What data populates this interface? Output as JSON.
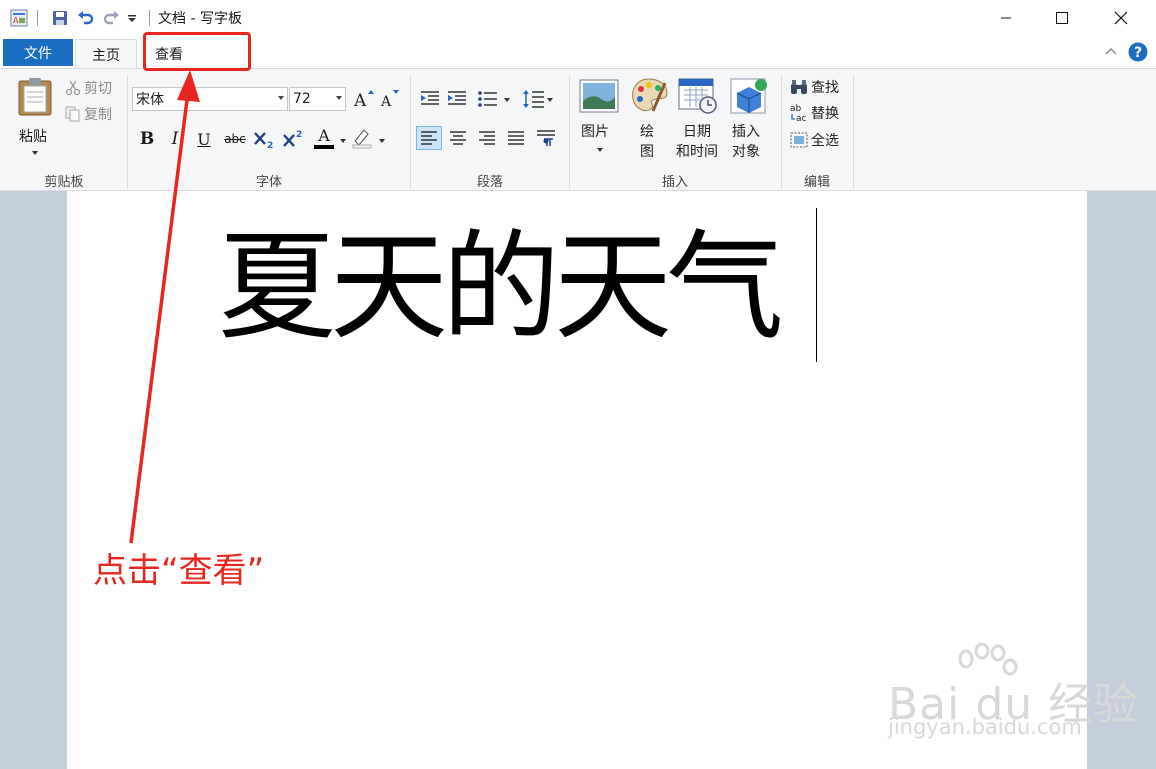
{
  "window": {
    "title": "文档 - 写字板"
  },
  "tabs": {
    "file": "文件",
    "home": "主页",
    "view": "查看"
  },
  "ribbon": {
    "clipboard": {
      "paste": "粘贴",
      "cut": "剪切",
      "copy": "复制",
      "group_label": "剪贴板"
    },
    "font": {
      "font_name": "宋体",
      "font_size": "72",
      "bold": "B",
      "italic": "I",
      "underline": "U",
      "strike": "abc",
      "font_color": "A",
      "group_label": "字体"
    },
    "paragraph": {
      "group_label": "段落"
    },
    "insert": {
      "picture": "图片",
      "paint_1": "绘",
      "paint_2": "图",
      "datetime_1": "日期",
      "datetime_2": "和时间",
      "object_1": "插入",
      "object_2": "对象",
      "group_label": "插入"
    },
    "editing": {
      "find": "查找",
      "replace": "替换",
      "select_all": "全选",
      "group_label": "编辑"
    }
  },
  "document": {
    "text": "夏天的天气"
  },
  "annotation": {
    "text": "点击“查看”",
    "color": "#e8261f"
  },
  "watermark": {
    "main": "Bai du 经验",
    "sub": "jingyan.baidu.com"
  },
  "colors": {
    "file_tab": "#1a6fc2",
    "ribbon_bg": "#f5f6f7",
    "workspace": "#c5cedb"
  }
}
